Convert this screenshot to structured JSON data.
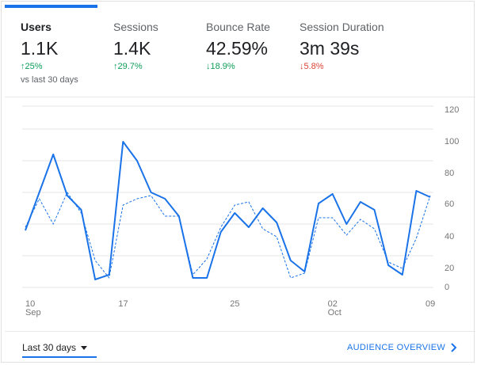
{
  "metrics": [
    {
      "label": "Users",
      "value": "1.1K",
      "change": "25%",
      "direction": "up",
      "compare": "vs last 30 days"
    },
    {
      "label": "Sessions",
      "value": "1.4K",
      "change": "29.7%",
      "direction": "up"
    },
    {
      "label": "Bounce Rate",
      "value": "42.59%",
      "change": "18.9%",
      "direction": "down"
    },
    {
      "label": "Session Duration",
      "value": "3m 39s",
      "change": "5.8%",
      "direction": "down"
    }
  ],
  "colors": {
    "accent": "#1a73e8",
    "positive": "#0f9d58",
    "negative": "#db4437"
  },
  "footer": {
    "date_range": "Last 30 days",
    "overview_link": "AUDIENCE OVERVIEW"
  },
  "chart_data": {
    "type": "line",
    "x_tick_labels": [
      {
        "day": "10",
        "month": "Sep",
        "index": 0
      },
      {
        "day": "17",
        "month": "",
        "index": 7
      },
      {
        "day": "25",
        "month": "",
        "index": 15
      },
      {
        "day": "02",
        "month": "Oct",
        "index": 22
      },
      {
        "day": "09",
        "month": "",
        "index": 29
      }
    ],
    "y_tick_labels": [
      "0",
      "20",
      "40",
      "60",
      "80",
      "100",
      "120"
    ],
    "ylim": [
      0,
      120
    ],
    "grid": true,
    "series": [
      {
        "values": [
          36,
          60,
          84,
          58,
          49,
          5,
          8,
          92,
          80,
          60,
          56,
          45,
          6,
          6,
          35,
          47,
          38,
          50,
          41,
          17,
          10,
          53,
          59,
          40,
          54,
          49,
          14,
          8,
          61,
          57
        ],
        "style": "solid"
      },
      {
        "values": [
          38,
          56,
          40,
          60,
          47,
          17,
          6,
          52,
          56,
          58,
          45,
          45,
          8,
          18,
          38,
          52,
          54,
          37,
          32,
          6,
          9,
          44,
          44,
          33,
          43,
          37,
          16,
          12,
          31,
          58
        ],
        "style": "dashed"
      }
    ]
  }
}
